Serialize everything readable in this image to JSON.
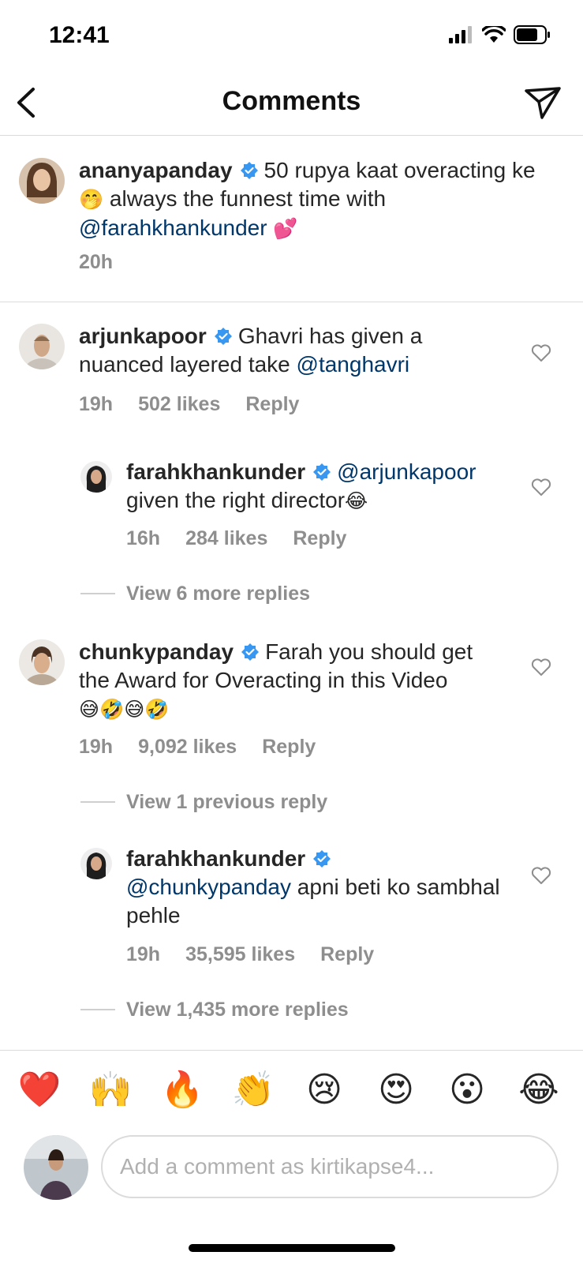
{
  "status_bar": {
    "time": "12:41"
  },
  "nav": {
    "title": "Comments"
  },
  "caption": {
    "username": "ananyapanday",
    "text_before_emoji": "50 rupya kaat overacting ke",
    "emoji": "🤭",
    "text_after_emoji": "always the funnest time with",
    "mention": "@farahkhankunder",
    "trailing_emoji": "💕",
    "time": "20h"
  },
  "comments": [
    {
      "username": "arjunkapoor",
      "text": "Ghavri has given a nuanced layered take",
      "mention": "@tanghavri",
      "time": "19h",
      "likes": "502 likes",
      "reply": "Reply"
    },
    {
      "username": "farahkhankunder",
      "mention": "@arjunkapoor",
      "text": "given the right director",
      "emoji": "😂",
      "time": "16h",
      "likes": "284 likes",
      "reply": "Reply"
    },
    {
      "username": "chunkypanday",
      "text": "Farah you should get the Award for Overacting in this Video",
      "emoji": "😅🤣😅🤣",
      "time": "19h",
      "likes": "9,092 likes",
      "reply": "Reply"
    },
    {
      "username": "farahkhankunder",
      "mention": "@chunkypanday",
      "text": "apni beti ko sambhal pehle",
      "time": "19h",
      "likes": "35,595 likes",
      "reply": "Reply"
    }
  ],
  "view_more": [
    "View 6 more replies",
    "View 1 previous reply",
    "View 1,435 more replies"
  ],
  "quick_emojis": [
    "❤️",
    "🙌",
    "🔥",
    "👏",
    "😢",
    "😍",
    "😮",
    "😂"
  ],
  "composer": {
    "placeholder": "Add a comment as kirtikapse4..."
  },
  "colors": {
    "mention": "#00376b",
    "verified": "#3897f0",
    "meta": "#8e8e8e"
  }
}
